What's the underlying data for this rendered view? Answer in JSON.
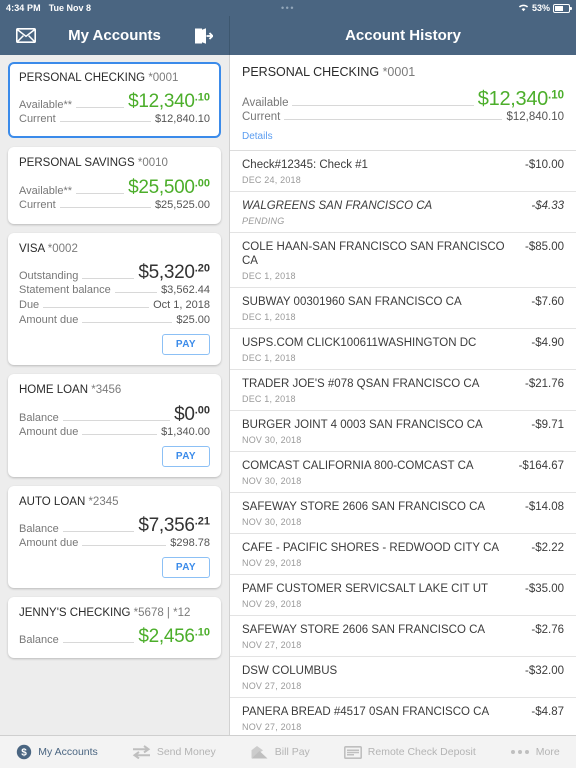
{
  "statusbar": {
    "time": "4:34 PM",
    "date": "Tue Nov 8",
    "dots": "•••",
    "battery_pct": "53%"
  },
  "navbar": {
    "left_title": "My Accounts",
    "right_title": "Account History",
    "mail_icon": "envelope-icon",
    "logout_icon": "logout-icon"
  },
  "sidebar": {
    "cards": [
      {
        "title": "PERSONAL CHECKING",
        "mask": "*0001",
        "selected": true,
        "primary": {
          "label": "Available**",
          "whole": "$12,340",
          "cents": ".10",
          "color": "green"
        },
        "rows": [
          {
            "label": "Current",
            "value": "$12,840.10"
          }
        ],
        "pay": null
      },
      {
        "title": "PERSONAL SAVINGS",
        "mask": "*0010",
        "selected": false,
        "primary": {
          "label": "Available**",
          "whole": "$25,500",
          "cents": ".00",
          "color": "green"
        },
        "rows": [
          {
            "label": "Current",
            "value": "$25,525.00"
          }
        ],
        "pay": null
      },
      {
        "title": "VISA",
        "mask": "*0002",
        "selected": false,
        "primary": {
          "label": "Outstanding",
          "whole": "$5,320",
          "cents": ".20",
          "color": "dark"
        },
        "rows": [
          {
            "label": "Statement balance",
            "value": "$3,562.44"
          },
          {
            "label": "Due",
            "value": "Oct 1, 2018"
          },
          {
            "label": "Amount due",
            "value": "$25.00"
          }
        ],
        "pay": "PAY"
      },
      {
        "title": "HOME LOAN",
        "mask": "*3456",
        "selected": false,
        "primary": {
          "label": "Balance",
          "whole": "$0",
          "cents": ".00",
          "color": "dark"
        },
        "rows": [
          {
            "label": "Amount due",
            "value": "$1,340.00"
          }
        ],
        "pay": "PAY"
      },
      {
        "title": "AUTO LOAN",
        "mask": "*2345",
        "selected": false,
        "primary": {
          "label": "Balance",
          "whole": "$7,356",
          "cents": ".21",
          "color": "dark"
        },
        "rows": [
          {
            "label": "Amount due",
            "value": "$298.78"
          }
        ],
        "pay": "PAY"
      },
      {
        "title": "JENNY'S CHECKING",
        "mask": "*5678 | *12",
        "selected": false,
        "primary": {
          "label": "Balance",
          "whole": "$2,456",
          "cents": ".10",
          "color": "green"
        },
        "rows": [],
        "pay": null
      }
    ]
  },
  "detail": {
    "account": {
      "title": "PERSONAL CHECKING",
      "mask": "*0001",
      "available_label": "Available",
      "available_whole": "$12,340",
      "available_cents": ".10",
      "current_label": "Current",
      "current_value": "$12,840.10",
      "details_link": "Details"
    },
    "transactions": [
      {
        "desc": "Check#12345: Check #1",
        "date": "DEC 24, 2018",
        "amount": "-$10.00",
        "pending": false
      },
      {
        "desc": "WALGREENS SAN FRANCISCO CA",
        "date": "PENDING",
        "amount": "-$4.33",
        "pending": true
      },
      {
        "desc": "COLE HAAN-SAN FRANCISCO SAN FRANCISCO CA",
        "date": "DEC 1, 2018",
        "amount": "-$85.00",
        "pending": false
      },
      {
        "desc": "SUBWAY 00301960 SAN FRANCISCO CA",
        "date": "DEC 1, 2018",
        "amount": "-$7.60",
        "pending": false
      },
      {
        "desc": "USPS.COM CLICK100611WASHINGTON DC",
        "date": "DEC 1, 2018",
        "amount": "-$4.90",
        "pending": false
      },
      {
        "desc": "TRADER JOE'S #078 QSAN FRANCISCO CA",
        "date": "DEC 1, 2018",
        "amount": "-$21.76",
        "pending": false
      },
      {
        "desc": "BURGER JOINT 4 0003 SAN FRANCISCO CA",
        "date": "NOV 30, 2018",
        "amount": "-$9.71",
        "pending": false
      },
      {
        "desc": "COMCAST CALIFORNIA 800-COMCAST CA",
        "date": "NOV 30, 2018",
        "amount": "-$164.67",
        "pending": false
      },
      {
        "desc": "SAFEWAY STORE 2606 SAN FRANCISCO CA",
        "date": "NOV 30, 2018",
        "amount": "-$14.08",
        "pending": false
      },
      {
        "desc": "CAFE - PACIFIC SHORES - REDWOOD CITY CA",
        "date": "NOV 29, 2018",
        "amount": "-$2.22",
        "pending": false
      },
      {
        "desc": "PAMF CUSTOMER SERVICSALT LAKE CIT UT",
        "date": "NOV 29, 2018",
        "amount": "-$35.00",
        "pending": false
      },
      {
        "desc": "SAFEWAY STORE 2606 SAN FRANCISCO CA",
        "date": "NOV 27, 2018",
        "amount": "-$2.76",
        "pending": false
      },
      {
        "desc": "DSW COLUMBUS",
        "date": "NOV 27, 2018",
        "amount": "-$32.00",
        "pending": false
      },
      {
        "desc": "PANERA BREAD #4517 0SAN FRANCISCO CA",
        "date": "NOV 27, 2018",
        "amount": "-$4.87",
        "pending": false
      }
    ]
  },
  "tabbar": {
    "tabs": [
      {
        "label": "My Accounts",
        "icon": "dollar-circle-icon",
        "active": true
      },
      {
        "label": "Send Money",
        "icon": "transfer-arrows-icon",
        "active": false
      },
      {
        "label": "Bill Pay",
        "icon": "envelope-pay-icon",
        "active": false
      },
      {
        "label": "Remote Check Deposit",
        "icon": "check-deposit-icon",
        "active": false
      },
      {
        "label": "More",
        "icon": "ellipsis-icon",
        "active": false
      }
    ]
  },
  "colors": {
    "nav_bg": "#4a6581",
    "accent_green": "#4cae2b",
    "accent_blue": "#3b8bea",
    "page_bg": "#ededed"
  }
}
